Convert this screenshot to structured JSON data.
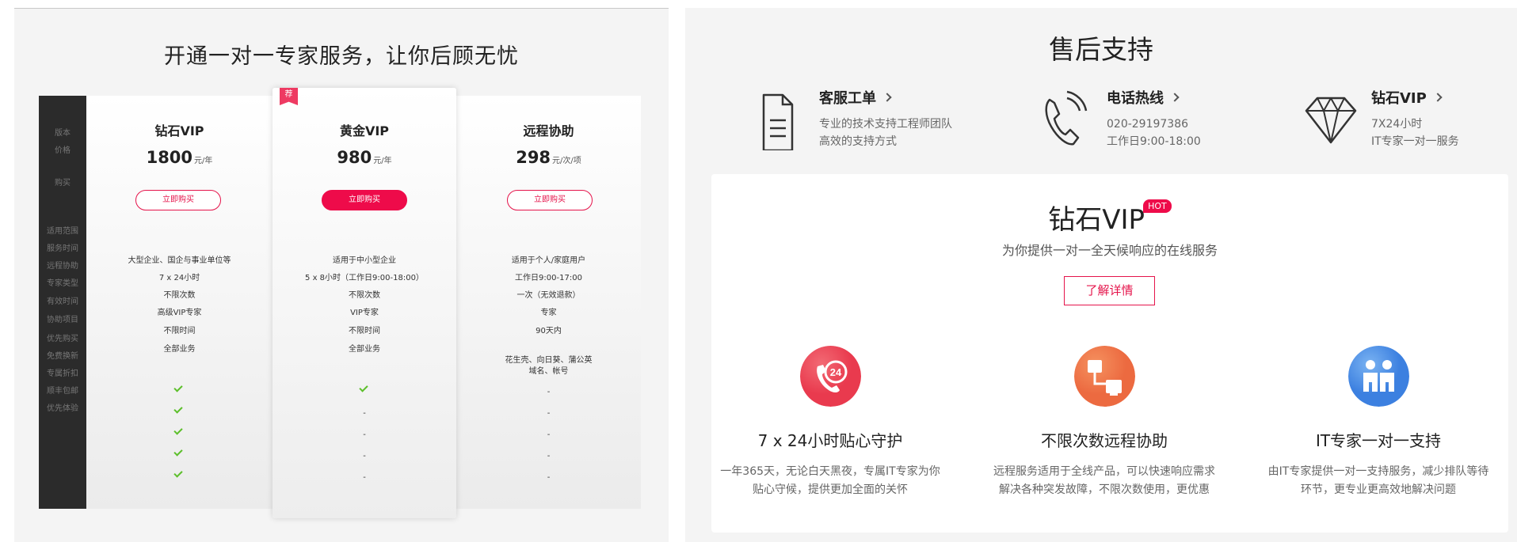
{
  "left": {
    "title": "开通一对一专家服务，让你后顾无忧",
    "row_labels": [
      "版本",
      "价格",
      "购买",
      "适用范围",
      "服务时间",
      "远程协助",
      "专家类型",
      "有效时间",
      "协助项目",
      "优先购买",
      "免费换新",
      "专属折扣",
      "顺丰包邮",
      "优先体验"
    ],
    "plans": [
      {
        "name": "钻石VIP",
        "price": "1800",
        "unit": "元/年",
        "buy_label": "立即购买",
        "rows": [
          "大型企业、国企与事业单位等",
          "7 x 24小时",
          "不限次数",
          "高级VIP专家",
          "不限时间",
          "全部业务"
        ],
        "extras": [
          "check",
          "check",
          "check",
          "check",
          "check"
        ]
      },
      {
        "name": "黄金VIP",
        "price": "980",
        "unit": "元/年",
        "buy_label": "立即购买",
        "badge": "荐",
        "rows": [
          "适用于中小型企业",
          "5 x 8小时（工作日9:00-18:00）",
          "不限次数",
          "VIP专家",
          "不限时间",
          "全部业务"
        ],
        "extras": [
          "check",
          "-",
          "-",
          "-",
          "-"
        ]
      },
      {
        "name": "远程协助",
        "price": "298",
        "unit": "元/次/项",
        "buy_label": "立即购买",
        "rows": [
          "适用于个人/家庭用户",
          "工作日9:00-17:00",
          "一次（无效退款）",
          "专家",
          "90天内",
          "花生壳、向日葵、蒲公英",
          "域名、帐号"
        ],
        "extras": [
          "-",
          "-",
          "-",
          "-",
          "-"
        ]
      }
    ]
  },
  "right": {
    "title": "售后支持",
    "services": [
      {
        "name": "客服工单",
        "desc1": "专业的技术支持工程师团队",
        "desc2": "高效的支持方式",
        "icon": "document-icon"
      },
      {
        "name": "电话热线",
        "desc1": "020-29197386",
        "desc2": "工作日9:00-18:00",
        "icon": "phone-icon"
      },
      {
        "name": "钻石VIP",
        "desc1": "7X24小时",
        "desc2": "IT专家一对一服务",
        "icon": "diamond-icon"
      }
    ],
    "vip": {
      "title": "钻石VIP",
      "hot": "HOT",
      "subtitle": "为你提供一对一全天候响应的在线服务",
      "detail_label": "了解详情"
    },
    "features": [
      {
        "icon_text": "24",
        "title": "7 x 24小时贴心守护",
        "desc1": "一年365天，无论白天黑夜，专属IT专家为你",
        "desc2": "贴心守候，提供更加全面的关怀",
        "color": "#ef4d5e"
      },
      {
        "title": "不限次数远程协助",
        "desc1": "远程服务适用于全线产品，可以快速响应需求",
        "desc2": "解决各种突发故障，不限次数使用，更优惠",
        "color": "#f0744a"
      },
      {
        "title": "IT专家一对一支持",
        "desc1": "由IT专家提供一对一支持服务，减少排队等待",
        "desc2": "环节，更专业更高效地解决问题",
        "color": "#4b8fe6"
      }
    ]
  }
}
